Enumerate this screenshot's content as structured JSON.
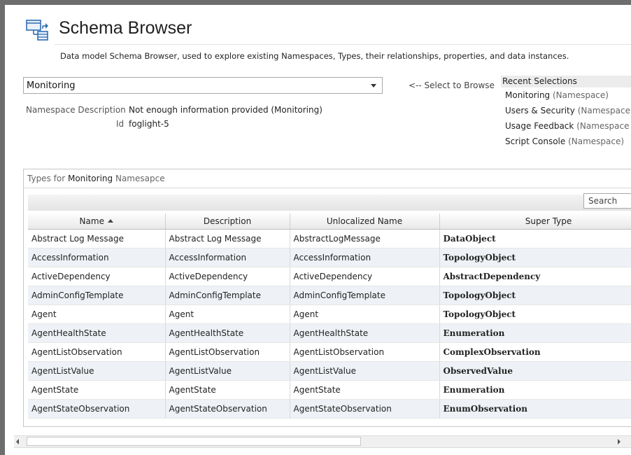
{
  "header": {
    "title": "Schema Browser",
    "subtitle": "Data model Schema Browser, used to explore existing Namespaces, Types, their relationships, properties, and data instances.",
    "icon": "schema-browser-icon"
  },
  "namespace_selector": {
    "selected": "Monitoring",
    "hint": "<-- Select to Browse"
  },
  "namespace_info": {
    "description_label": "Namespace Description",
    "description_value": "Not enough information provided (Monitoring)",
    "id_label": "Id",
    "id_value": "foglight-5"
  },
  "recent": {
    "header": "Recent Selections",
    "items": [
      {
        "name": "Monitoring",
        "type": "(Namespace)"
      },
      {
        "name": "Users & Security",
        "type": "(Namespace"
      },
      {
        "name": "Usage Feedback",
        "type": "(Namespace"
      },
      {
        "name": "Script Console",
        "type": "(Namespace)"
      }
    ]
  },
  "types_panel": {
    "caption_prefix": "Types for",
    "caption_namespace": "Monitoring",
    "caption_suffix": "Namesapce",
    "search_label": "Search",
    "columns": [
      "Name",
      "Description",
      "Unlocalized Name",
      "Super Type"
    ],
    "sort_column": "Name",
    "sort_direction": "ascending",
    "rows": [
      {
        "name": "Abstract Log Message",
        "description": "Abstract Log Message",
        "unlocalized": "AbstractLogMessage",
        "super": "DataObject"
      },
      {
        "name": "AccessInformation",
        "description": "AccessInformation",
        "unlocalized": "AccessInformation",
        "super": "TopologyObject"
      },
      {
        "name": "ActiveDependency",
        "description": "ActiveDependency",
        "unlocalized": "ActiveDependency",
        "super": "AbstractDependency"
      },
      {
        "name": "AdminConfigTemplate",
        "description": "AdminConfigTemplate",
        "unlocalized": "AdminConfigTemplate",
        "super": "TopologyObject"
      },
      {
        "name": "Agent",
        "description": "Agent",
        "unlocalized": "Agent",
        "super": "TopologyObject"
      },
      {
        "name": "AgentHealthState",
        "description": "AgentHealthState",
        "unlocalized": "AgentHealthState",
        "super": "Enumeration"
      },
      {
        "name": "AgentListObservation",
        "description": "AgentListObservation",
        "unlocalized": "AgentListObservation",
        "super": "ComplexObservation"
      },
      {
        "name": "AgentListValue",
        "description": "AgentListValue",
        "unlocalized": "AgentListValue",
        "super": "ObservedValue"
      },
      {
        "name": "AgentState",
        "description": "AgentState",
        "unlocalized": "AgentState",
        "super": "Enumeration"
      },
      {
        "name": "AgentStateObservation",
        "description": "AgentStateObservation",
        "unlocalized": "AgentStateObservation",
        "super": "EnumObservation"
      }
    ]
  },
  "colors": {
    "window_frame": "#6d6d6d",
    "alt_row": "#eef2f6",
    "icon_blue": "#2f6db3"
  }
}
